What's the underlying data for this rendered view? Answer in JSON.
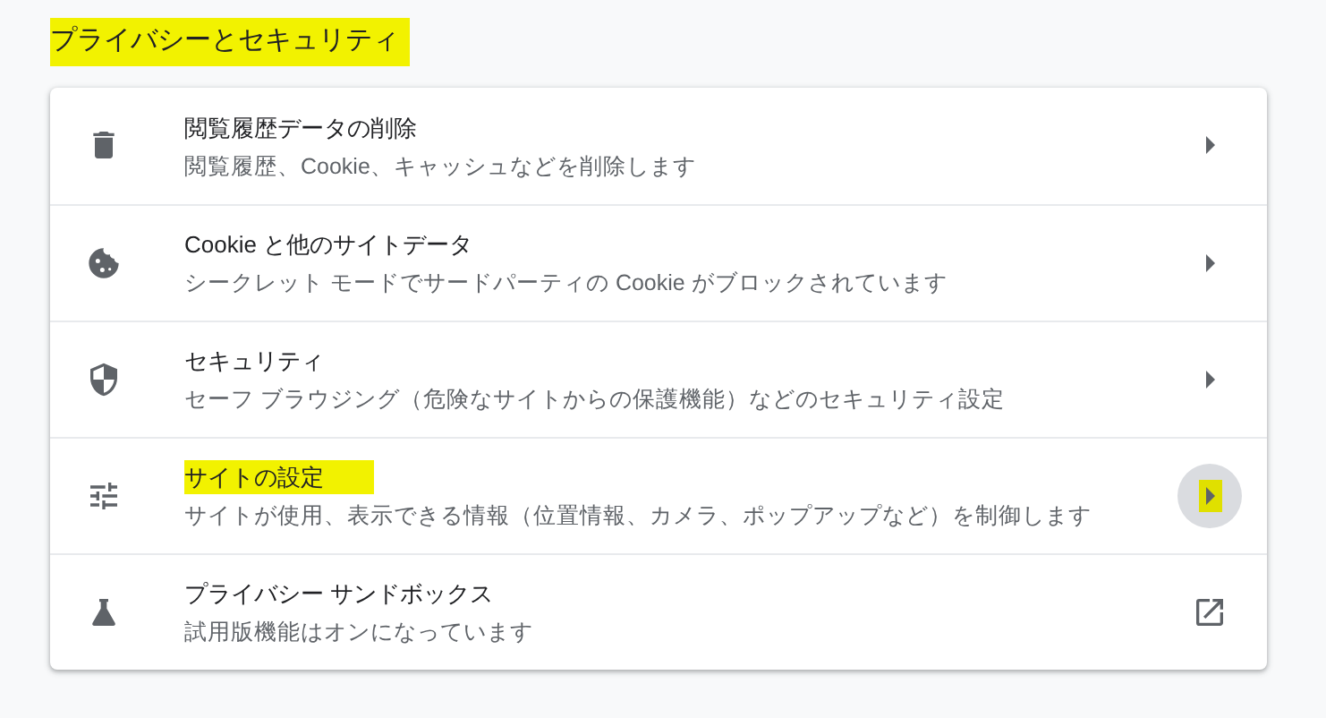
{
  "section": {
    "title": "プライバシーとセキュリティ",
    "highlighted": true
  },
  "items": [
    {
      "kind": "submenu",
      "title": "閲覧履歴データの削除",
      "subtitle": "閲覧履歴、Cookie、キャッシュなどを削除します",
      "highlighted": false,
      "hovered": false
    },
    {
      "kind": "submenu",
      "title": "Cookie と他のサイトデータ",
      "subtitle": "シークレット モードでサードパーティの Cookie がブロックされています",
      "highlighted": false,
      "hovered": false
    },
    {
      "kind": "submenu",
      "title": "セキュリティ",
      "subtitle": "セーフ ブラウジング（危険なサイトからの保護機能）などのセキュリティ設定",
      "highlighted": false,
      "hovered": false
    },
    {
      "kind": "submenu",
      "title": "サイトの設定",
      "subtitle": "サイトが使用、表示できる情報（位置情報、カメラ、ポップアップなど）を制御します",
      "highlighted": true,
      "hovered": true
    },
    {
      "kind": "external",
      "title": "プライバシー サンドボックス",
      "subtitle": "試用版機能はオンになっています",
      "highlighted": false,
      "hovered": false
    }
  ]
}
